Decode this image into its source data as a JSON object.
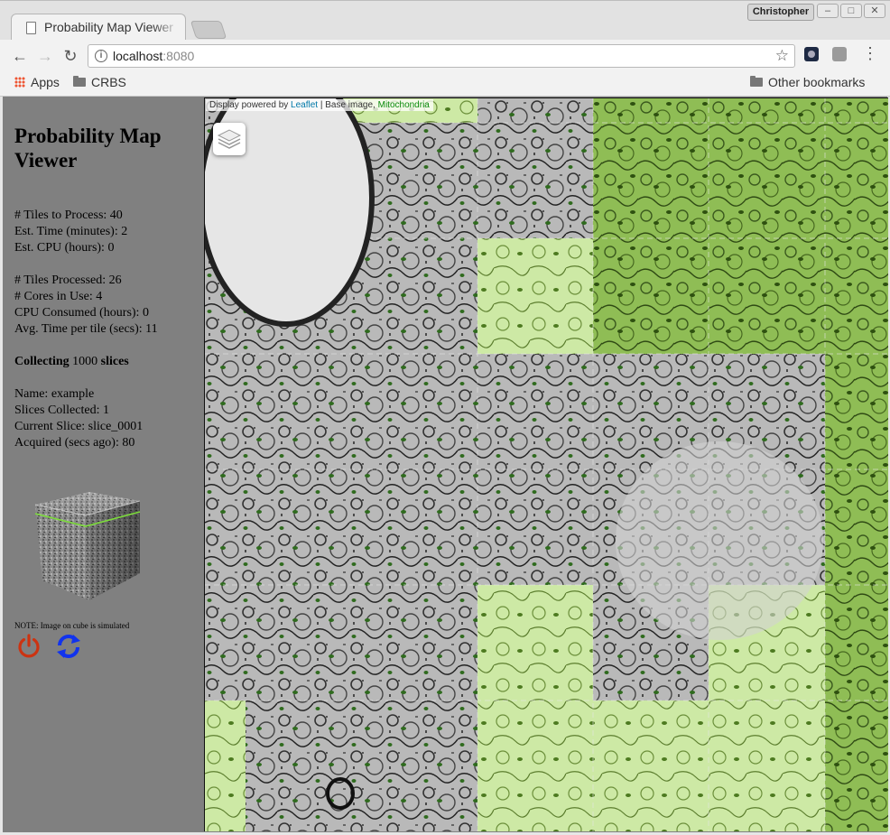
{
  "browser": {
    "tab_title": "Probability Map Viewer",
    "profile_name": "Christopher",
    "url_host": "localhost",
    "url_port": ":8080",
    "bookmarks": [
      "Apps",
      "CRBS"
    ],
    "other_bookmarks": "Other bookmarks"
  },
  "sidebar": {
    "title": "Probability Map Viewer",
    "tiles_to_process": "# Tiles to Process: 40",
    "est_time": "Est. Time (minutes): 2",
    "est_cpu": "Est. CPU (hours): 0",
    "tiles_processed": "# Tiles Processed: 26",
    "cores_in_use": "# Cores in Use: 4",
    "cpu_consumed": "CPU Consumed (hours): 0",
    "avg_time": "Avg. Time per tile (secs): 11",
    "collecting_prefix": "Collecting",
    "collecting_count": " 1000 ",
    "collecting_suffix": "slices",
    "name": "Name: example",
    "slices_collected": "Slices Collected: 1",
    "current_slice": "Current Slice: slice_0001",
    "acquired": "Acquired (secs ago): 80",
    "note": "NOTE: Image on cube is simulated"
  },
  "map": {
    "attribution_prefix": "Display powered by ",
    "attribution_leaflet": "Leaflet",
    "attribution_middle": " | Base image, ",
    "attribution_layer": "Mitochondria",
    "tiles_processed": 26,
    "tiles_total": 40,
    "overlay_color": "#8bc34a"
  },
  "colors": {
    "power_icon": "#cc3311",
    "refresh_icon": "#1133ee",
    "leaflet_link": "#0078a8",
    "layer_link": "#0a8a0a"
  }
}
